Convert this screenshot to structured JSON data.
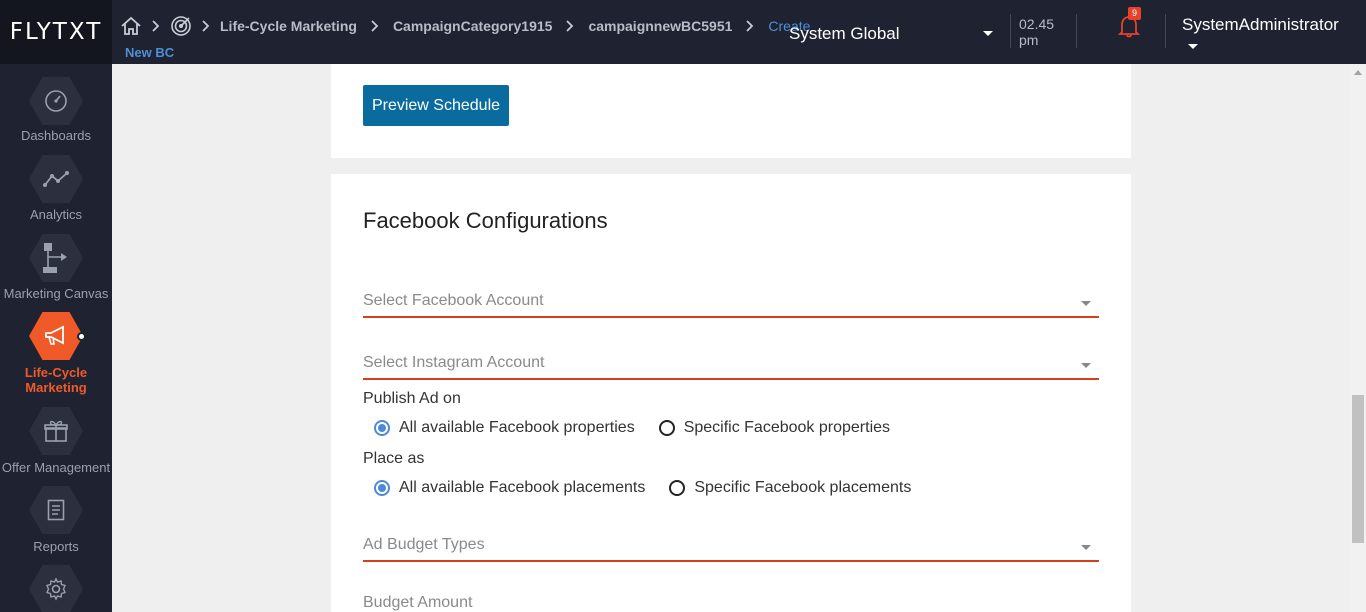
{
  "app": {
    "logo": "FLYTXT"
  },
  "header": {
    "breadcrumbs": [
      "Life-Cycle Marketing",
      "CampaignCategory1915",
      "campaignnewBC5951"
    ],
    "current": "Create",
    "current_line2": "New BC",
    "org": "System Global",
    "time": "02.45 pm",
    "notifications": "9",
    "user": "SystemAdministrator"
  },
  "sidebar": {
    "items": [
      {
        "label": "Dashboards",
        "icon": "speedometer-icon",
        "active": false
      },
      {
        "label": "Analytics",
        "icon": "line-chart-icon",
        "active": false
      },
      {
        "label": "Marketing Canvas",
        "icon": "flow-canvas-icon",
        "active": false
      },
      {
        "label": "Life-Cycle Marketing",
        "icon": "megaphone-icon",
        "active": true
      },
      {
        "label": "Offer Management",
        "icon": "gift-icon",
        "active": false
      },
      {
        "label": "Reports",
        "icon": "document-icon",
        "active": false
      },
      {
        "label": "",
        "icon": "gear-icon",
        "active": false
      }
    ]
  },
  "main": {
    "preview_button": "Preview Schedule",
    "section_title": "Facebook Configurations",
    "facebook_account_placeholder": "Select Facebook Account",
    "instagram_account_placeholder": "Select Instagram Account",
    "publish_label": "Publish Ad on",
    "publish_options": [
      "All available Facebook properties",
      "Specific Facebook properties"
    ],
    "publish_selected": "All available Facebook properties",
    "place_label": "Place as",
    "place_options": [
      "All available Facebook placements",
      "Specific Facebook placements"
    ],
    "place_selected": "All available Facebook placements",
    "budget_type_placeholder": "Ad Budget Types",
    "budget_amount_label": "Budget Amount"
  },
  "colors": {
    "accent": "#f05a28",
    "primary_button": "#0a6c9e",
    "link": "#4f8fd8",
    "field_underline": "#d5401c"
  }
}
